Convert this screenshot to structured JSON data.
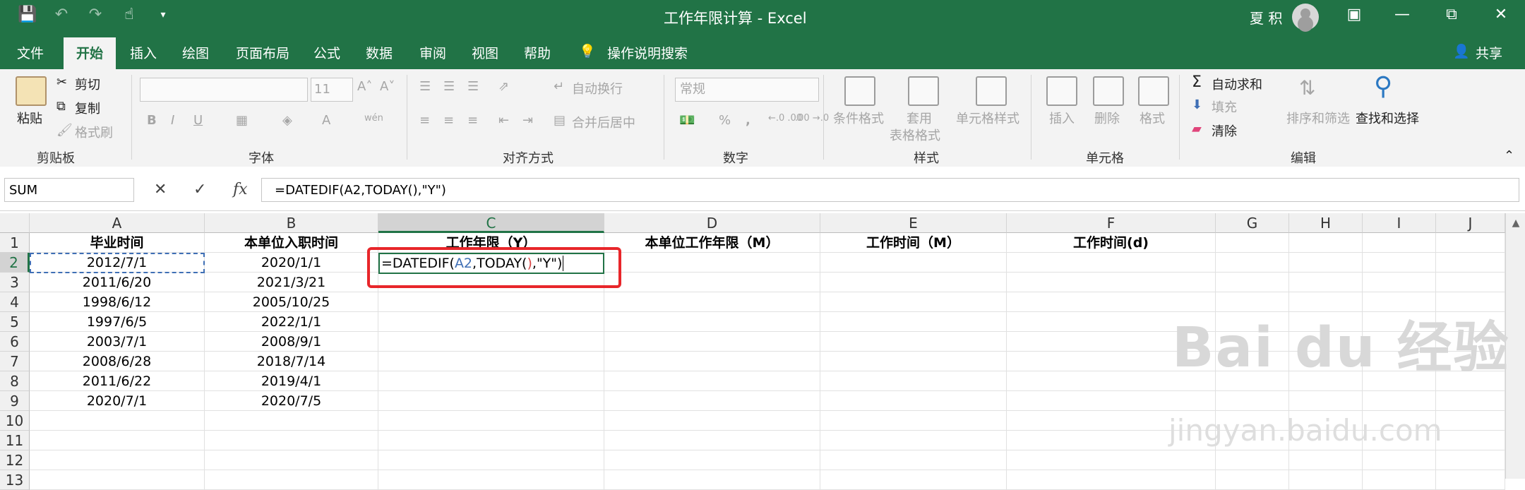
{
  "titlebar": {
    "title": "工作年限计算 - Excel",
    "user": "夏 积",
    "share": "共享",
    "qat_icons": [
      "save-icon",
      "undo-icon",
      "redo-icon",
      "touch-mode-icon",
      "customize-icon"
    ]
  },
  "tabs": [
    "文件",
    "开始",
    "插入",
    "绘图",
    "页面布局",
    "公式",
    "数据",
    "审阅",
    "视图",
    "帮助"
  ],
  "active_tab": "开始",
  "tell_me": "操作说明搜索",
  "ribbon": {
    "clipboard": {
      "paste": "粘贴",
      "cut": "剪切",
      "copy": "复制",
      "format_painter": "格式刷",
      "label": "剪贴板"
    },
    "font": {
      "size": "11",
      "bold": "B",
      "italic": "I",
      "underline": "U",
      "font_color": "A",
      "wen": "wén",
      "label": "字体"
    },
    "alignment": {
      "wrap": "自动换行",
      "merge": "合并后居中",
      "label": "对齐方式"
    },
    "number": {
      "format": "常规",
      "percent": "%",
      "comma": ",",
      "inc_dec": "←.0 .00",
      "dec_dec": ".00 →.0",
      "label": "数字"
    },
    "styles": {
      "conditional": "条件格式",
      "table": "套用\n表格格式",
      "cell_styles": "单元格样式",
      "label": "样式"
    },
    "cells": {
      "insert": "插入",
      "delete": "删除",
      "format": "格式",
      "label": "单元格"
    },
    "editing": {
      "autosum": "自动求和",
      "fill": "填充",
      "clear": "清除",
      "sort": "排序和筛选",
      "find": "查找和选择",
      "label": "编辑"
    }
  },
  "formula_bar": {
    "name_box": "SUM",
    "fx": "fx",
    "formula": "=DATEDIF(A2,TODAY(),\"Y\")"
  },
  "columns": [
    "A",
    "B",
    "C",
    "D",
    "E",
    "F",
    "G",
    "H",
    "I",
    "J"
  ],
  "rows": [
    "1",
    "2",
    "3",
    "4",
    "5",
    "6",
    "7",
    "8",
    "9",
    "10",
    "11",
    "12",
    "13"
  ],
  "headers": {
    "A": "毕业时间",
    "B": "本单位入职时间",
    "C": "工作年限（Y）",
    "D": "本单位工作年限（M）",
    "E": "工作时间（M）",
    "F": "工作时间(d)"
  },
  "data": [
    [
      "2012/7/1",
      "2020/1/1"
    ],
    [
      "2011/6/20",
      "2021/3/21"
    ],
    [
      "1998/6/12",
      "2005/10/25"
    ],
    [
      "1997/6/5",
      "2022/1/1"
    ],
    [
      "2003/7/1",
      "2008/9/1"
    ],
    [
      "2008/6/28",
      "2018/7/14"
    ],
    [
      "2011/6/22",
      "2019/4/1"
    ],
    [
      "2020/7/1",
      "2020/7/5"
    ]
  ],
  "edit_cell": {
    "prefix": "=DATEDIF(",
    "ref": "A2",
    "mid": ",TODAY(",
    "paren": ")",
    "tail": ",\"Y\")"
  },
  "watermark": {
    "brand": "Bai du 经验",
    "url": "jingyan.baidu.com"
  }
}
